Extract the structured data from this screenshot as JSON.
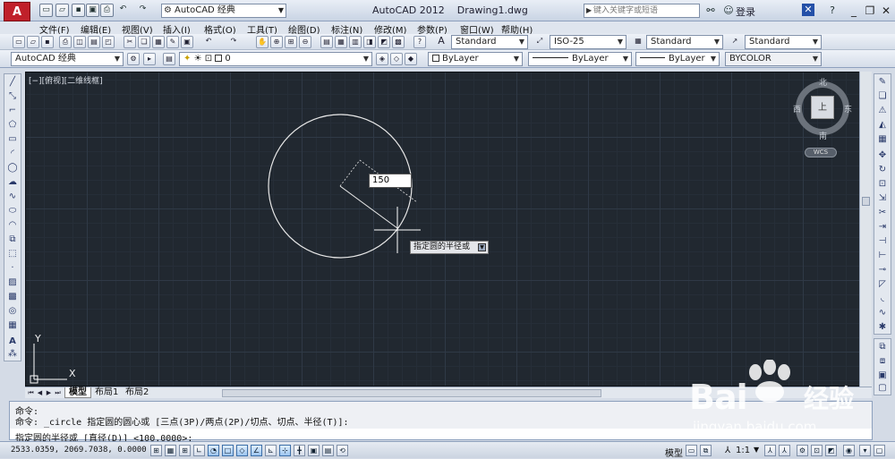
{
  "app": {
    "logo": "A",
    "workspace": "AutoCAD 经典",
    "title": "AutoCAD 2012",
    "document": "Drawing1.dwg",
    "search_placeholder": "键入关键字或短语",
    "login": "登录"
  },
  "menu": [
    "文件(F)",
    "编辑(E)",
    "视图(V)",
    "插入(I)",
    "格式(O)",
    "工具(T)",
    "绘图(D)",
    "标注(N)",
    "修改(M)",
    "参数(P)",
    "窗口(W)",
    "帮助(H)"
  ],
  "styles": {
    "text_style": "Standard",
    "dim_style": "ISO-25",
    "table_style": "Standard",
    "multileader_style": "Standard"
  },
  "layers": {
    "workspace": "AutoCAD 经典",
    "current_layer": "0",
    "color": "ByLayer",
    "linetype": "ByLayer",
    "lineweight": "ByLayer",
    "plotstyle": "BYCOLOR"
  },
  "viewport": {
    "label": "[−][俯视][二维线框]",
    "radius_input": "150",
    "tooltip": "指定圆的半径或",
    "compass": {
      "north": "北",
      "south": "南",
      "east": "东",
      "west": "西",
      "top": "上"
    },
    "wcs": "WCS",
    "ucs_y": "Y",
    "ucs_x": "X"
  },
  "tabs": [
    "模型",
    "布局1",
    "布局2"
  ],
  "command": {
    "history": [
      "命令:",
      "命令: _circle 指定圆的圆心或 [三点(3P)/两点(2P)/切点、切点、半径(T)]:"
    ],
    "prompt": "指定圆的半径或 [直径(D)] <100.0000>:"
  },
  "status": {
    "coords": "2533.0359, 2069.7038, 0.0000",
    "model": "模型",
    "scale": "1:1"
  },
  "watermark": {
    "brand": "Bai",
    "brand2": "经验",
    "url": "jingyan.baidu.com"
  },
  "colors": {
    "canvas": "#212830",
    "crosshair": "#ffffff",
    "accent": "#c0202a"
  }
}
